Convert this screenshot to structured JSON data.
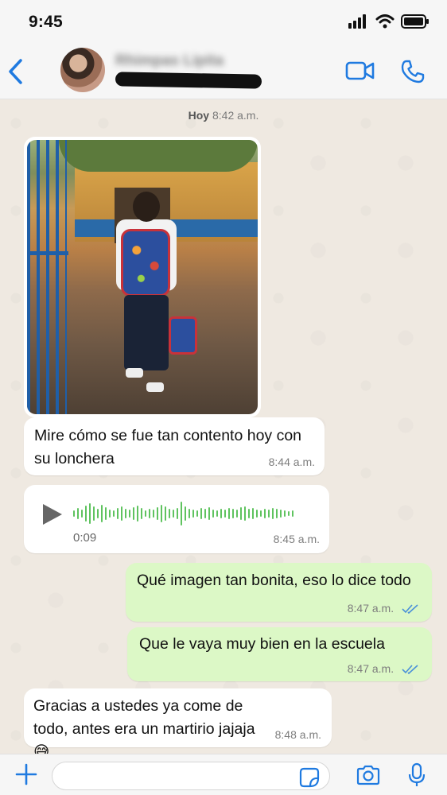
{
  "status_bar": {
    "time": "9:45"
  },
  "header": {
    "contact_name": "Rhimpas Lipita",
    "icons": {
      "back": "chevron-left-icon",
      "video": "video-icon",
      "call": "phone-icon"
    },
    "accent_color": "#1f7ae0"
  },
  "chat": {
    "date_label": "Hoy",
    "date_time": "8:42 a.m.",
    "messages": [
      {
        "type": "image",
        "direction": "incoming"
      },
      {
        "type": "text",
        "direction": "incoming",
        "text": "Mire cómo se fue tan contento hoy con su lonchera",
        "time": "8:44 a.m."
      },
      {
        "type": "voice",
        "direction": "incoming",
        "duration": "0:09",
        "time": "8:45 a.m."
      },
      {
        "type": "text",
        "direction": "outgoing",
        "text": "Qué imagen tan bonita, eso lo dice todo",
        "time": "8:47 a.m.",
        "status": "read"
      },
      {
        "type": "text",
        "direction": "outgoing",
        "text": "Que le vaya muy bien en la escuela",
        "time": "8:47 a.m.",
        "status": "read"
      },
      {
        "type": "text",
        "direction": "incoming",
        "text": "Gracias a ustedes ya come de todo, antes era un martirio jajaja 😅",
        "time": "8:48 a.m."
      }
    ]
  },
  "input_bar": {
    "placeholder": "",
    "icons": {
      "plus": "plus-icon",
      "sticker": "sticker-icon",
      "camera": "camera-icon",
      "mic": "microphone-icon"
    }
  },
  "colors": {
    "incoming_bubble": "#ffffff",
    "outgoing_bubble": "#dcf8c6",
    "read_ticks": "#4a90d9",
    "waveform": "#5fc35f"
  }
}
